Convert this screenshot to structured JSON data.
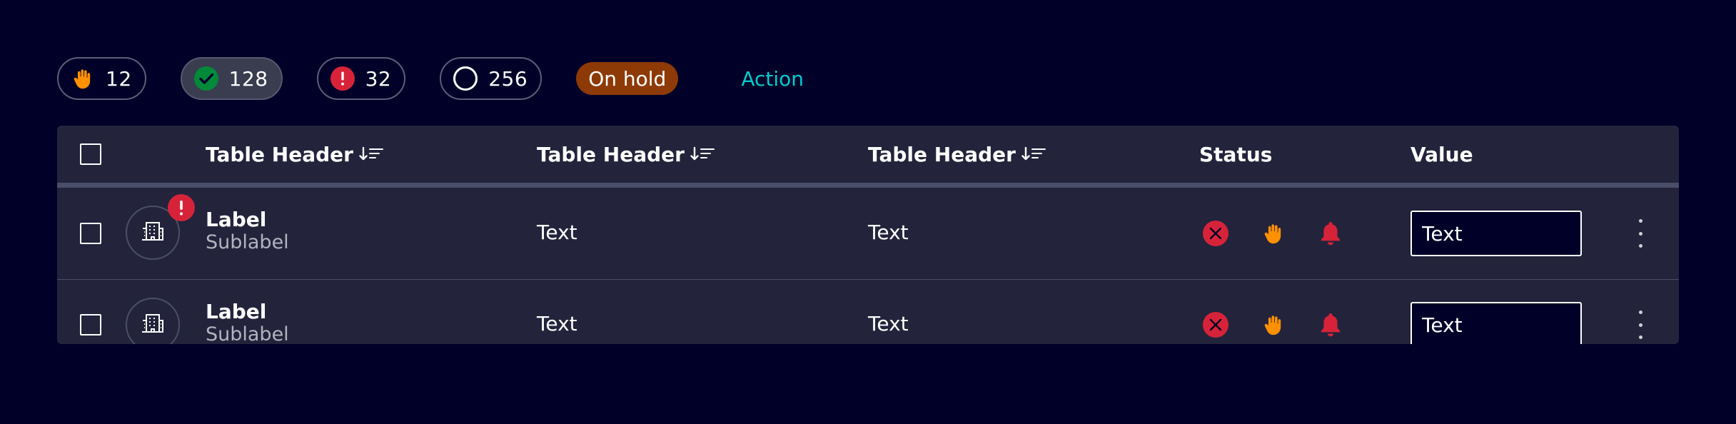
{
  "filters": [
    {
      "icon": "hand-icon",
      "count": "12",
      "active": false,
      "color": "#ff9000"
    },
    {
      "icon": "check-circle-icon",
      "count": "128",
      "active": true,
      "color": "#01893a"
    },
    {
      "icon": "alarm-circle-icon",
      "count": "32",
      "active": false,
      "color": "#d72339"
    },
    {
      "icon": "empty-circle-icon",
      "count": "256",
      "active": false,
      "color": "#ffffff"
    }
  ],
  "badge": {
    "label": "On hold",
    "color": "#8e3a06"
  },
  "action": {
    "label": "Action",
    "color": "#00cccc"
  },
  "table": {
    "headers": [
      "Table Header",
      "Table Header",
      "Table Header",
      "Status",
      "Value"
    ],
    "rows": [
      {
        "label": "Label",
        "sublabel": "Sublabel",
        "avatar_icon": "building-icon",
        "alert": true,
        "col2": "Text",
        "col3": "Text",
        "status_icons": [
          "error-x-icon",
          "hand-icon",
          "bell-icon"
        ],
        "value": "Text"
      },
      {
        "label": "Label",
        "sublabel": "Sublabel",
        "avatar_icon": "building-icon",
        "alert": false,
        "col2": "Text",
        "col3": "Text",
        "status_icons": [
          "error-x-icon",
          "hand-icon",
          "bell-icon"
        ],
        "value": "Text"
      }
    ]
  },
  "colors": {
    "background": "#000028",
    "table_bg": "#23233c",
    "error": "#d72339",
    "warning": "#ff9000",
    "success": "#01893a",
    "accent": "#00cccc"
  }
}
